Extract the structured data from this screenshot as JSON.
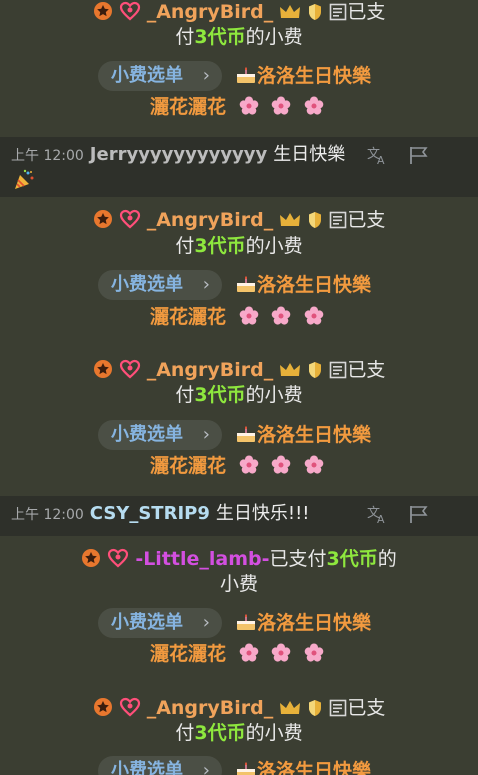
{
  "tip_messages": [
    {
      "user": "_AngryBird_",
      "text_before_amount": "已支付",
      "amount": "3代币",
      "text_after_amount": "的小费",
      "line1_tail": "已支",
      "line2_head": "付",
      "menu_label": "小费选单",
      "item_label_a": "洛洛生日快樂",
      "item_label_b": "灑花灑花"
    },
    {
      "user": "_AngryBird_",
      "line1_tail": "已支",
      "line2_head": "付",
      "amount": "3代币",
      "text_after_amount": "的小费",
      "menu_label": "小费选单",
      "item_label_a": "洛洛生日快樂",
      "item_label_b": "灑花灑花"
    },
    {
      "user": "_AngryBird_",
      "line1_tail": "已支",
      "line2_head": "付",
      "amount": "3代币",
      "text_after_amount": "的小费",
      "menu_label": "小费选单",
      "item_label_a": "洛洛生日快樂",
      "item_label_b": "灑花灑花"
    },
    {
      "user": "-Little_lamb-",
      "line1_text": "已支付",
      "amount": "3代币",
      "line1_after": "的",
      "line2_text": "小费",
      "menu_label": "小费选单",
      "item_label_a": "洛洛生日快樂",
      "item_label_b": "灑花灑花"
    },
    {
      "user": "_AngryBird_",
      "line1_tail": "已支",
      "line2_head": "付",
      "amount": "3代币",
      "text_after_amount": "的小费",
      "menu_label": "小费选单",
      "item_label_a": "洛洛生日快樂"
    }
  ],
  "chats": [
    {
      "time": "上午 12:00",
      "user": "Jerryyyyyyyyyyyy",
      "message": "生日快樂"
    },
    {
      "time": "上午 12:00",
      "user": "CSY_STRIP9",
      "message": "生日快乐!!!"
    }
  ],
  "colors": {
    "background": "#3b3e32",
    "chat_row_background": "#2e302a",
    "username_orange": "#f0a35b",
    "username_purple": "#d34fe0",
    "coins_green": "#8ee73e",
    "menu_item_orange": "#f29a3f",
    "menu_button_text": "#86b4e0"
  },
  "icons": [
    "star-badge-icon",
    "heart-icon",
    "crown-icon",
    "shield-icon",
    "note-icon",
    "cake-icon",
    "cherry-blossom-icon",
    "party-popper-icon",
    "translate-icon",
    "flag-icon",
    "chevron-right-icon"
  ]
}
